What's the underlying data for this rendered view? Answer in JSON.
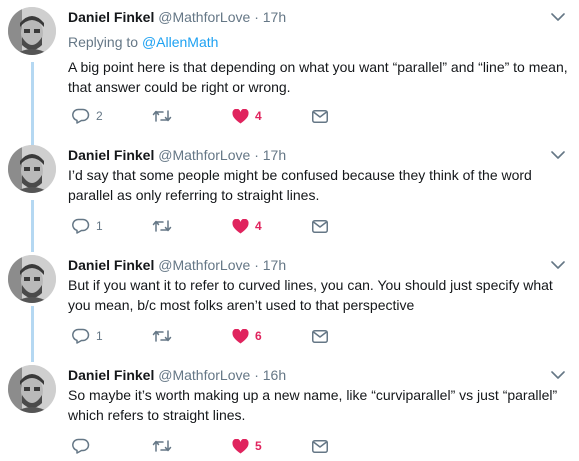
{
  "tweets": [
    {
      "name": "Daniel Finkel",
      "handle": "@MathforLove",
      "time": "17h",
      "reply_prefix": "Replying to ",
      "reply_to": "@AllenMath",
      "text": "A big point here is that depending on what you want “parallel” and “line” to mean, that answer could be right or wrong.",
      "replies": "2",
      "retweets": "",
      "likes": "4"
    },
    {
      "name": "Daniel Finkel",
      "handle": "@MathforLove",
      "time": "17h",
      "text": "I’d say that some people might be confused because they think of the word parallel as only referring to straight lines.",
      "replies": "1",
      "retweets": "",
      "likes": "4"
    },
    {
      "name": "Daniel Finkel",
      "handle": "@MathforLove",
      "time": "17h",
      "text": "But if you want it to refer to curved lines, you can. You should just specify what you mean, b/c most folks aren’t used to that perspective",
      "replies": "1",
      "retweets": "",
      "likes": "6"
    },
    {
      "name": "Daniel Finkel",
      "handle": "@MathforLove",
      "time": "16h",
      "text": "So maybe it’s worth making up a new name, like “curviparallel” vs just “parallel” which refers to straight lines.",
      "replies": "",
      "retweets": "",
      "likes": "5"
    }
  ],
  "separator": "·",
  "icons": {
    "reply": "reply-icon",
    "retweet": "retweet-icon",
    "like": "heart-icon",
    "dm": "envelope-icon",
    "menu": "chevron-down-icon"
  },
  "colors": {
    "like": "#e0245e",
    "link": "#1da1f2",
    "muted": "#657786",
    "thread_line": "#b5d8f2"
  }
}
